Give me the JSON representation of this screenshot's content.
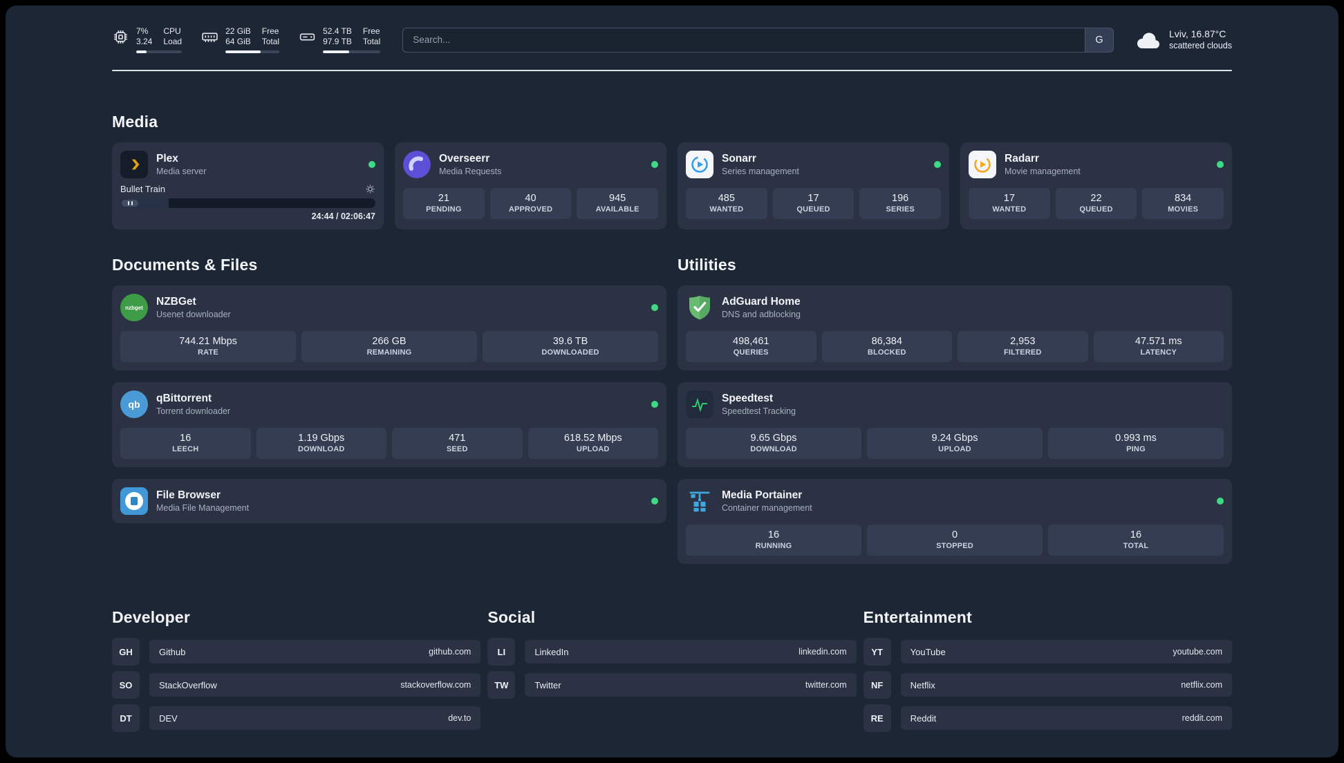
{
  "colors": {
    "status_online": "#3ddc84",
    "plex_accent": "#e5a00d",
    "speedtest_line": "#2ecc71",
    "adguard_green": "#68bc71",
    "portainer_blue": "#3fa7e0"
  },
  "topbar": {
    "cpu": {
      "icon": "cpu-icon",
      "value": "7%",
      "sub": "3.24",
      "label": "CPU",
      "sublabel": "Load",
      "progress": 22
    },
    "ram": {
      "icon": "ram-icon",
      "value": "22 GiB",
      "sub": "64 GiB",
      "label": "Free",
      "sublabel": "Total",
      "progress": 65
    },
    "disk": {
      "icon": "disk-icon",
      "value": "52.4 TB",
      "sub": "97.9 TB",
      "label": "Free",
      "sublabel": "Total",
      "progress": 46
    },
    "search": {
      "placeholder": "Search...",
      "button": "G"
    },
    "weather": {
      "icon": "cloud-icon",
      "location": "Lviv, 16.87°C",
      "condition": "scattered clouds"
    }
  },
  "sections": {
    "media": "Media",
    "documents": "Documents & Files",
    "utilities": "Utilities"
  },
  "apps": {
    "plex": {
      "name": "Plex",
      "subtitle": "Media server",
      "icon": "plex-icon",
      "status": "online",
      "now_playing": {
        "title": "Bullet Train",
        "time": "24:44 / 02:06:47",
        "progress": 19
      }
    },
    "overseerr": {
      "name": "Overseerr",
      "subtitle": "Media Requests",
      "icon": "overseerr-icon",
      "status": "online",
      "stats": [
        {
          "value": "21",
          "label": "PENDING"
        },
        {
          "value": "40",
          "label": "APPROVED"
        },
        {
          "value": "945",
          "label": "AVAILABLE"
        }
      ]
    },
    "sonarr": {
      "name": "Sonarr",
      "subtitle": "Series management",
      "icon": "sonarr-icon",
      "status": "online",
      "stats": [
        {
          "value": "485",
          "label": "WANTED"
        },
        {
          "value": "17",
          "label": "QUEUED"
        },
        {
          "value": "196",
          "label": "SERIES"
        }
      ]
    },
    "radarr": {
      "name": "Radarr",
      "subtitle": "Movie management",
      "icon": "radarr-icon",
      "status": "online",
      "stats": [
        {
          "value": "17",
          "label": "WANTED"
        },
        {
          "value": "22",
          "label": "QUEUED"
        },
        {
          "value": "834",
          "label": "MOVIES"
        }
      ]
    },
    "nzbget": {
      "name": "NZBGet",
      "subtitle": "Usenet downloader",
      "icon": "nzbget-icon",
      "icon_text": "nzbget",
      "status": "online",
      "stats": [
        {
          "value": "744.21 Mbps",
          "label": "RATE"
        },
        {
          "value": "266 GB",
          "label": "REMAINING"
        },
        {
          "value": "39.6 TB",
          "label": "DOWNLOADED"
        }
      ]
    },
    "qbittorrent": {
      "name": "qBittorrent",
      "subtitle": "Torrent downloader",
      "icon": "qbittorrent-icon",
      "icon_text": "qb",
      "status": "online",
      "stats": [
        {
          "value": "16",
          "label": "LEECH"
        },
        {
          "value": "1.19 Gbps",
          "label": "DOWNLOAD"
        },
        {
          "value": "471",
          "label": "SEED"
        },
        {
          "value": "618.52 Mbps",
          "label": "UPLOAD"
        }
      ]
    },
    "filebrowser": {
      "name": "File Browser",
      "subtitle": "Media File Management",
      "icon": "filebrowser-icon",
      "status": "online"
    },
    "adguard": {
      "name": "AdGuard Home",
      "subtitle": "DNS and adblocking",
      "icon": "adguard-icon",
      "stats": [
        {
          "value": "498,461",
          "label": "QUERIES"
        },
        {
          "value": "86,384",
          "label": "BLOCKED"
        },
        {
          "value": "2,953",
          "label": "FILTERED"
        },
        {
          "value": "47.571 ms",
          "label": "LATENCY"
        }
      ]
    },
    "speedtest": {
      "name": "Speedtest",
      "subtitle": "Speedtest Tracking",
      "icon": "speedtest-icon",
      "stats": [
        {
          "value": "9.65 Gbps",
          "label": "DOWNLOAD"
        },
        {
          "value": "9.24 Gbps",
          "label": "UPLOAD"
        },
        {
          "value": "0.993 ms",
          "label": "PING"
        }
      ]
    },
    "portainer": {
      "name": "Media Portainer",
      "subtitle": "Container management",
      "icon": "portainer-icon",
      "status": "online",
      "stats": [
        {
          "value": "16",
          "label": "RUNNING"
        },
        {
          "value": "0",
          "label": "STOPPED"
        },
        {
          "value": "16",
          "label": "TOTAL"
        }
      ]
    }
  },
  "bookmarks": {
    "developer": {
      "title": "Developer",
      "items": [
        {
          "abbr": "GH",
          "name": "Github",
          "url": "github.com"
        },
        {
          "abbr": "SO",
          "name": "StackOverflow",
          "url": "stackoverflow.com"
        },
        {
          "abbr": "DT",
          "name": "DEV",
          "url": "dev.to"
        }
      ]
    },
    "social": {
      "title": "Social",
      "items": [
        {
          "abbr": "LI",
          "name": "LinkedIn",
          "url": "linkedin.com"
        },
        {
          "abbr": "TW",
          "name": "Twitter",
          "url": "twitter.com"
        }
      ]
    },
    "entertainment": {
      "title": "Entertainment",
      "items": [
        {
          "abbr": "YT",
          "name": "YouTube",
          "url": "youtube.com"
        },
        {
          "abbr": "NF",
          "name": "Netflix",
          "url": "netflix.com"
        },
        {
          "abbr": "RE",
          "name": "Reddit",
          "url": "reddit.com"
        }
      ]
    }
  }
}
